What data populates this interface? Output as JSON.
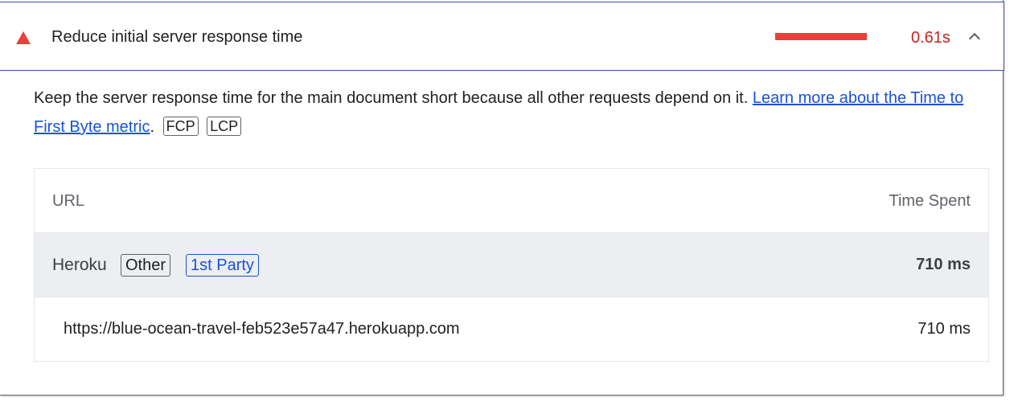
{
  "audit": {
    "title": "Reduce initial server response time",
    "metric_value": "0.61s",
    "metric_fill": 1.0,
    "colors": {
      "fail": "#e8403a",
      "fail_text": "#c5221f",
      "link": "#1a52d8"
    },
    "icons": {
      "status": "warning-triangle-icon",
      "toggle": "chevron-up-icon"
    }
  },
  "description": {
    "text": "Keep the server response time for the main document short because all other requests depend on it. ",
    "link_text": "Learn more about the Time to First Byte metric",
    "after_link": ".",
    "tags": [
      "FCP",
      "LCP"
    ]
  },
  "table": {
    "headers": {
      "url": "URL",
      "time": "Time Spent"
    },
    "group": {
      "name": "Heroku",
      "tags": [
        "Other",
        "1st Party"
      ],
      "time": "710 ms"
    },
    "rows": [
      {
        "url": "https://blue-ocean-travel-feb523e57a47.herokuapp.com",
        "time": "710 ms"
      }
    ]
  }
}
